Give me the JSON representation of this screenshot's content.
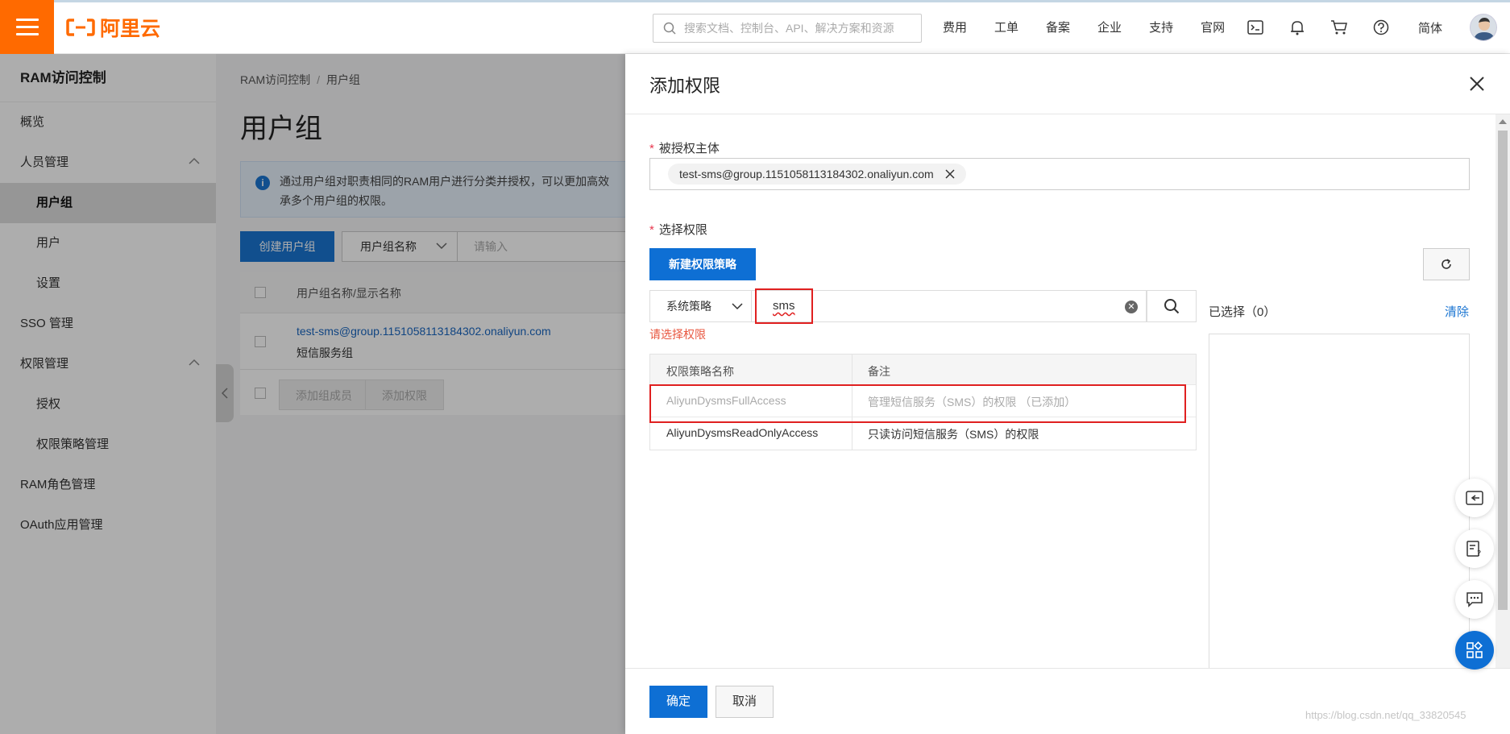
{
  "topnav": {
    "brand": "阿里云",
    "search_placeholder": "搜索文档、控制台、API、解决方案和资源",
    "links": [
      "费用",
      "工单",
      "备案",
      "企业",
      "支持",
      "官网"
    ],
    "icons": [
      "terminal-icon",
      "bell-icon",
      "cart-icon",
      "help-icon"
    ],
    "lang": "简体"
  },
  "sidebar": {
    "title": "RAM访问控制",
    "items": [
      {
        "label": "概览"
      },
      {
        "label": "人员管理"
      },
      {
        "label": "用户组"
      },
      {
        "label": "用户"
      },
      {
        "label": "设置"
      },
      {
        "label": "SSO 管理"
      },
      {
        "label": "权限管理"
      },
      {
        "label": "授权"
      },
      {
        "label": "权限策略管理"
      },
      {
        "label": "RAM角色管理"
      },
      {
        "label": "OAuth应用管理"
      }
    ]
  },
  "main": {
    "breadcrumb": [
      "RAM访问控制",
      "/",
      "用户组"
    ],
    "title": "用户组",
    "info_line1": "通过用户组对职责相同的RAM用户进行分类并授权，可以更加高效",
    "info_line2": "承多个用户组的权限。",
    "create_button": "创建用户组",
    "filter_select": "用户组名称",
    "filter_placeholder": "请输入",
    "table_header": "用户组名称/显示名称",
    "row_name": "test-sms@group.1151058113184302.onaliyun.com",
    "row_display": "短信服务组",
    "add_member_button": "添加组成员",
    "add_permission_button": "添加权限"
  },
  "drawer": {
    "title": "添加权限",
    "principal_label": "被授权主体",
    "principal_tag": "test-sms@group.1151058113184302.onaliyun.com",
    "select_label": "选择权限",
    "new_policy_button": "新建权限策略",
    "policy_type": "系统策略",
    "search_value": "sms",
    "error_tip": "请选择权限",
    "table": {
      "headers": [
        "权限策略名称",
        "备注"
      ],
      "rows": [
        {
          "name": "AliyunDysmsFullAccess",
          "note": "管理短信服务（SMS）的权限 （已添加）"
        },
        {
          "name": "AliyunDysmsReadOnlyAccess",
          "note": "只读访问短信服务（SMS）的权限"
        }
      ]
    },
    "selected_label": "已选择（0）",
    "clear_link": "清除",
    "ok_button": "确定",
    "cancel_button": "取消",
    "watermark": "https://blog.csdn.net/qq_33820545"
  },
  "colors": {
    "brand_orange": "#ff6a00",
    "primary_blue": "#0e6fd4",
    "highlight_red": "#e02020"
  }
}
